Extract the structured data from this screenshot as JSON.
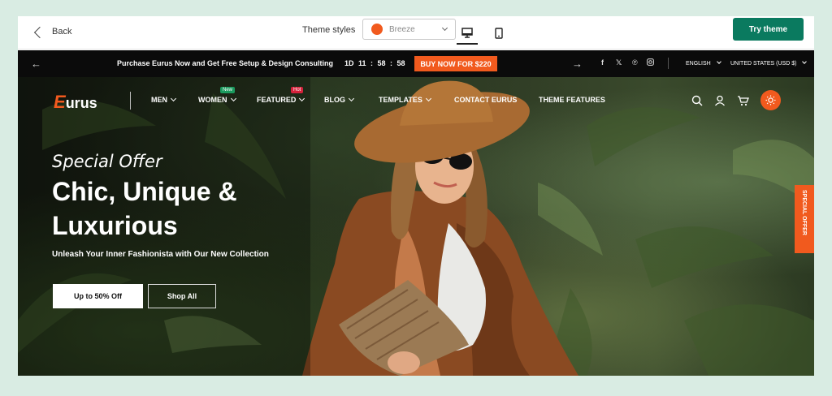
{
  "toolbar": {
    "back_label": "Back",
    "theme_styles_label": "Theme styles",
    "theme_style_value": "Breeze",
    "theme_style_color": "#f15a1e",
    "try_theme_label": "Try theme",
    "accent": "#0a7a5f"
  },
  "announcement": {
    "text": "Purchase Eurus Now and Get Free Setup & Design Consulting",
    "countdown": "1D  11 : 58 : 58",
    "buy_label": "BUY NOW FOR $220",
    "language": "ENGLISH",
    "currency": "UNITED STATES (USD $)",
    "social_icons": [
      "facebook-icon",
      "x-icon",
      "pinterest-icon",
      "instagram-icon"
    ]
  },
  "nav": {
    "logo_mark": "E",
    "logo_text": "urus",
    "items": [
      {
        "label": "MEN",
        "dropdown": true
      },
      {
        "label": "WOMEN",
        "dropdown": true,
        "badge": "New",
        "badge_color": "#1a9a5e"
      },
      {
        "label": "FEATURED",
        "dropdown": true,
        "badge": "Hot",
        "badge_color": "#d4213b"
      },
      {
        "label": "BLOG",
        "dropdown": true
      },
      {
        "label": "TEMPLATES",
        "dropdown": true
      },
      {
        "label": "CONTACT EURUS",
        "dropdown": false
      },
      {
        "label": "THEME FEATURES",
        "dropdown": false
      }
    ],
    "icons": [
      "search-icon",
      "user-icon",
      "cart-icon",
      "sun-icon"
    ]
  },
  "hero": {
    "eyebrow": "Special Offer",
    "headline": "Chic, Unique & Luxurious",
    "subline": "Unleash Your Inner Fashionista with Our New Collection",
    "cta_primary": "Up to 50% Off",
    "cta_secondary": "Shop All",
    "side_tab": "SPECIAL OFFER"
  }
}
